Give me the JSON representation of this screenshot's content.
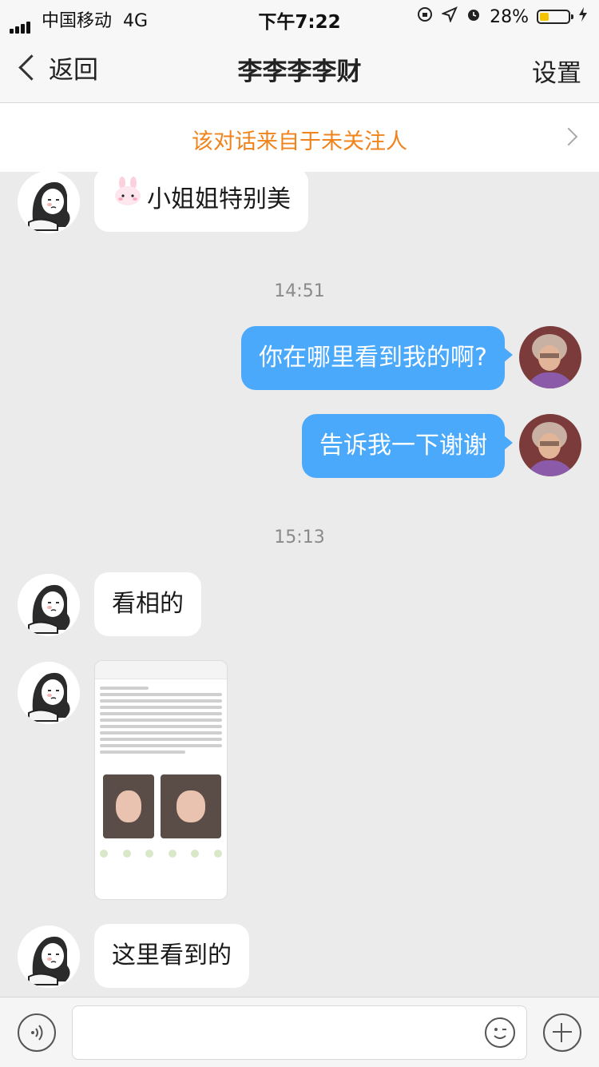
{
  "status_bar": {
    "carrier": "中国移动",
    "network": "4G",
    "time": "下午7:22",
    "battery": "28%",
    "battery_color": "#f5c400"
  },
  "nav": {
    "back_label": "返回",
    "title": "李李李李财",
    "settings_label": "设置"
  },
  "banner": {
    "text": "该对话来自于未关注人",
    "color": "#f0831c"
  },
  "messages": [
    {
      "side": "left",
      "text": "小姐姐特别美",
      "emoji": "rabbit-emoji"
    },
    {
      "type": "time",
      "text": "14:51"
    },
    {
      "side": "right",
      "text": "你在哪里看到我的啊?"
    },
    {
      "side": "right",
      "text": "告诉我一下谢谢"
    },
    {
      "type": "time",
      "text": "15:13"
    },
    {
      "side": "left",
      "text": "看相的"
    },
    {
      "side": "left",
      "type": "image",
      "image_desc": "screenshot-icon"
    },
    {
      "side": "left",
      "text": "这里看到的"
    }
  ],
  "colors": {
    "outgoing_bubble": "#4aa9fb",
    "incoming_bubble": "#ffffff",
    "chat_background": "#ebebeb"
  },
  "input_bar": {
    "left_icon": "voice-icon",
    "emoji_icon": "emoji-icon",
    "right_icon": "plus-icon"
  }
}
